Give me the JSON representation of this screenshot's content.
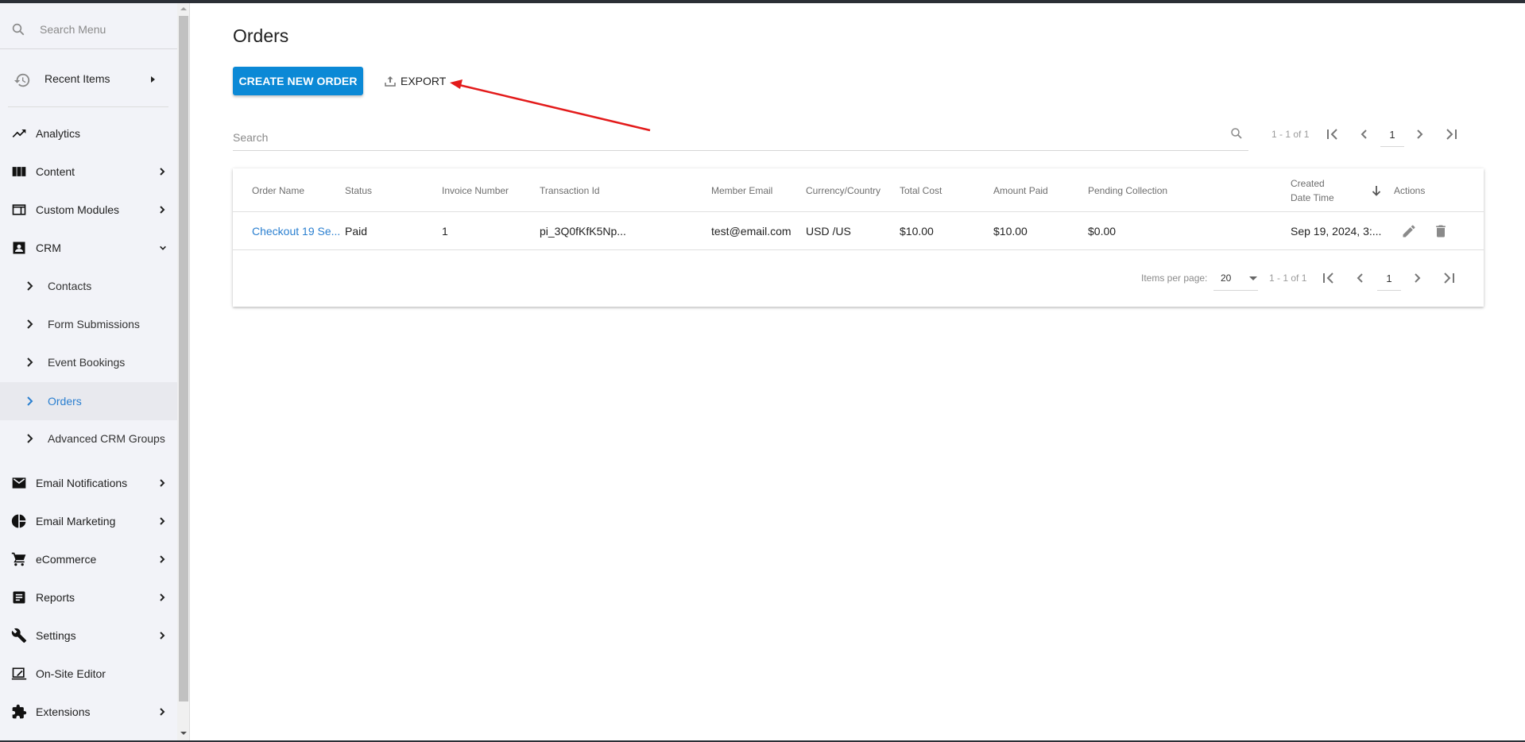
{
  "sidebar": {
    "search_placeholder": "Search Menu",
    "recent_items_label": "Recent Items",
    "items": [
      {
        "label": "Analytics",
        "icon": "trending-up-icon",
        "has_chevron": false
      },
      {
        "label": "Content",
        "icon": "columns-icon",
        "has_chevron": true
      },
      {
        "label": "Custom Modules",
        "icon": "web-module-icon",
        "has_chevron": true
      },
      {
        "label": "CRM",
        "icon": "contact-card-icon",
        "expanded": true
      }
    ],
    "crm_children": [
      {
        "label": "Contacts"
      },
      {
        "label": "Form Submissions"
      },
      {
        "label": "Event Bookings"
      },
      {
        "label": "Orders",
        "active": true
      },
      {
        "label": "Advanced CRM Groups"
      }
    ],
    "items_after": [
      {
        "label": "Email Notifications",
        "icon": "mail-icon"
      },
      {
        "label": "Email Marketing",
        "icon": "pie-chart-icon"
      },
      {
        "label": "eCommerce",
        "icon": "cart-icon"
      },
      {
        "label": "Reports",
        "icon": "document-icon"
      },
      {
        "label": "Settings",
        "icon": "wrench-icon"
      },
      {
        "label": "On-Site Editor",
        "icon": "laptop-edit-icon"
      },
      {
        "label": "Extensions",
        "icon": "puzzle-icon"
      }
    ]
  },
  "page": {
    "title": "Orders",
    "create_button": "CREATE NEW ORDER",
    "export_button": "EXPORT",
    "search_placeholder": "Search"
  },
  "top_paginator": {
    "range": "1 - 1 of 1",
    "page": "1"
  },
  "table": {
    "columns": [
      "Order Name",
      "Status",
      "Invoice Number",
      "Transaction Id",
      "Member Email",
      "Currency/Country",
      "Total Cost",
      "Amount Paid",
      "Pending Collection",
      "Created Date Time",
      "Actions"
    ],
    "sorted_column": "Created Date Time",
    "sort_direction": "descending",
    "rows": [
      {
        "order_name": "Checkout 19 Se...",
        "status": "Paid",
        "invoice_number": "1",
        "transaction_id": "pi_3Q0fKfK5Np...",
        "member_email": "test@email.com",
        "currency_country": "USD /US",
        "total_cost": "$10.00",
        "amount_paid": "$10.00",
        "pending_collection": "$0.00",
        "created": "Sep 19, 2024, 3:..."
      }
    ]
  },
  "bottom_paginator": {
    "items_per_page_label": "Items per page:",
    "items_per_page": "20",
    "range": "1 - 1 of 1",
    "page": "1"
  },
  "colors": {
    "primary": "#0b89d6",
    "link": "#2a7fd0",
    "annotation_arrow": "#e31b1b",
    "sidebar_bg": "#f2f3f8"
  }
}
